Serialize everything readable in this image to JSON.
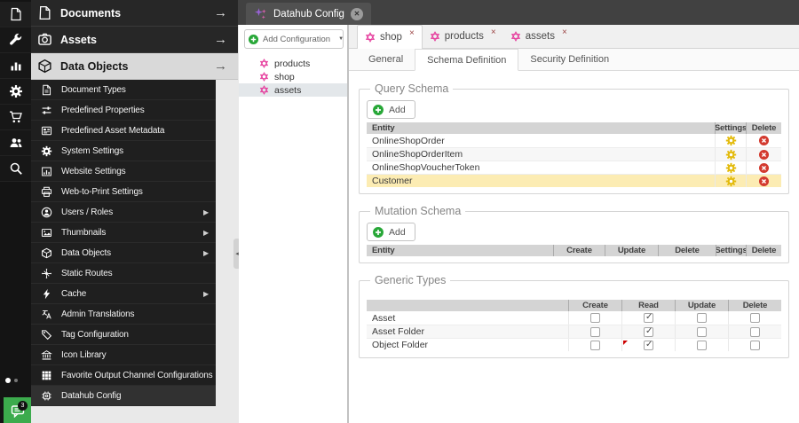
{
  "icon_bar": {
    "items": [
      {
        "icon": "file"
      },
      {
        "icon": "wrench"
      },
      {
        "icon": "chart"
      },
      {
        "icon": "gear"
      },
      {
        "icon": "cart"
      },
      {
        "icon": "users"
      },
      {
        "icon": "search"
      }
    ],
    "chat_badge": "3"
  },
  "sidebar": {
    "headers": [
      {
        "label": "Documents",
        "icon": "file",
        "active": false
      },
      {
        "label": "Assets",
        "icon": "camera",
        "active": false
      },
      {
        "label": "Data Objects",
        "icon": "cube",
        "active": true
      }
    ],
    "items": [
      {
        "label": "Document Types",
        "icon": "doc"
      },
      {
        "label": "Predefined Properties",
        "icon": "sliders"
      },
      {
        "label": "Predefined Asset Metadata",
        "icon": "metadata"
      },
      {
        "label": "System Settings",
        "icon": "gear"
      },
      {
        "label": "Website Settings",
        "icon": "website"
      },
      {
        "label": "Web-to-Print Settings",
        "icon": "printer"
      },
      {
        "label": "Users / Roles",
        "icon": "user-circle",
        "submenu": true
      },
      {
        "label": "Thumbnails",
        "icon": "image",
        "submenu": true
      },
      {
        "label": "Data Objects",
        "icon": "cube",
        "submenu": true
      },
      {
        "label": "Static Routes",
        "icon": "hub"
      },
      {
        "label": "Cache",
        "icon": "bolt",
        "submenu": true
      },
      {
        "label": "Admin Translations",
        "icon": "translate"
      },
      {
        "label": "Tag Configuration",
        "icon": "tag"
      },
      {
        "label": "Icon Library",
        "icon": "bank"
      },
      {
        "label": "Favorite Output Channel Configurations",
        "icon": "grid"
      },
      {
        "label": "Datahub Config",
        "icon": "chip",
        "active": true
      }
    ]
  },
  "window_tab": {
    "title": "Datahub Config"
  },
  "config_panel": {
    "add_button": "Add Configuration",
    "items": [
      {
        "label": "products",
        "selected": false
      },
      {
        "label": "shop",
        "selected": false
      },
      {
        "label": "assets",
        "selected": true
      }
    ]
  },
  "main": {
    "tabs": [
      {
        "label": "shop",
        "active": true
      },
      {
        "label": "products",
        "active": false
      },
      {
        "label": "assets",
        "active": false
      }
    ],
    "subtabs": [
      {
        "label": "General",
        "active": false
      },
      {
        "label": "Schema Definition",
        "active": true
      },
      {
        "label": "Security Definition",
        "active": false
      }
    ],
    "query_schema": {
      "legend": "Query Schema",
      "add_label": "Add",
      "columns": [
        "Entity",
        "Settings",
        "Delete"
      ],
      "rows": [
        {
          "entity": "OnlineShopOrder",
          "selected": false
        },
        {
          "entity": "OnlineShopOrderItem",
          "selected": false
        },
        {
          "entity": "OnlineShopVoucherToken",
          "selected": false
        },
        {
          "entity": "Customer",
          "selected": true
        }
      ]
    },
    "mutation_schema": {
      "legend": "Mutation Schema",
      "add_label": "Add",
      "columns": [
        "Entity",
        "Create",
        "Update",
        "Delete",
        "Settings",
        "Delete"
      ],
      "rows": []
    },
    "generic_types": {
      "legend": "Generic Types",
      "columns": [
        "",
        "Create",
        "Read",
        "Update",
        "Delete"
      ],
      "rows": [
        {
          "label": "Asset",
          "create": false,
          "read": true,
          "update": false,
          "delete": false,
          "dirty": false
        },
        {
          "label": "Asset Folder",
          "create": false,
          "read": true,
          "update": false,
          "delete": false,
          "dirty": false
        },
        {
          "label": "Object Folder",
          "create": false,
          "read": true,
          "update": false,
          "delete": false,
          "dirty": true
        }
      ]
    }
  },
  "colors": {
    "accent_pink": "#e5399b",
    "accent_green": "#27a737",
    "selection_yellow": "#fcecb3",
    "delete_red": "#d33a2f",
    "settings_yellow": "#e8c412"
  }
}
